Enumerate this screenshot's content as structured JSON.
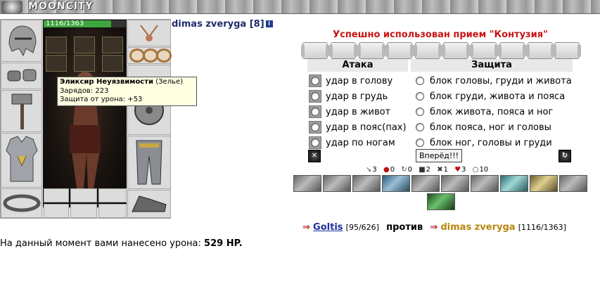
{
  "app": {
    "brand": "MOONCITY"
  },
  "character": {
    "name": "dimas zveryga",
    "level": "[8]",
    "info_icon_label": "i",
    "hp_text": "1116/1363",
    "hp_fraction": 0.819
  },
  "tooltip": {
    "item_name": "Эликсир Неуязвимости",
    "item_type": "(Зелье)",
    "line1": "Зарядов: 223",
    "line2": "Защита от урона: +53"
  },
  "battle": {
    "message": "Успешно использован прием \"Контузия\"",
    "attack_header": "Атака",
    "defense_header": "Защита",
    "attacks": [
      "удар в голову",
      "удар в грудь",
      "удар в живот",
      "удар в пояс(пах)",
      "удар по ногам"
    ],
    "defenses": [
      "блок головы, груди и живота",
      "блок груди, живота и пояса",
      "блок живота, пояса и ног",
      "блок пояса, ног и головы",
      "блок ног, головы и груди"
    ],
    "go_button": "Вперёд!!!",
    "stats": [
      {
        "icon": "sword-icon",
        "value": "3"
      },
      {
        "icon": "blood-drop-icon",
        "value": "0"
      },
      {
        "icon": "counter-icon",
        "value": "0"
      },
      {
        "icon": "shield-icon",
        "value": "2"
      },
      {
        "icon": "cross-icon",
        "value": "1"
      },
      {
        "icon": "heart-icon",
        "value": "3"
      },
      {
        "icon": "spirit-icon",
        "value": "10"
      }
    ]
  },
  "versus": {
    "player_name": "Goltis",
    "player_hp": "[95/626]",
    "vs_word": "против",
    "opponent_name": "dimas zveryga",
    "opponent_hp": "[1116/1363]"
  },
  "damage": {
    "text": "На данный момент вами нанесено урона:",
    "value": "529 HP."
  }
}
